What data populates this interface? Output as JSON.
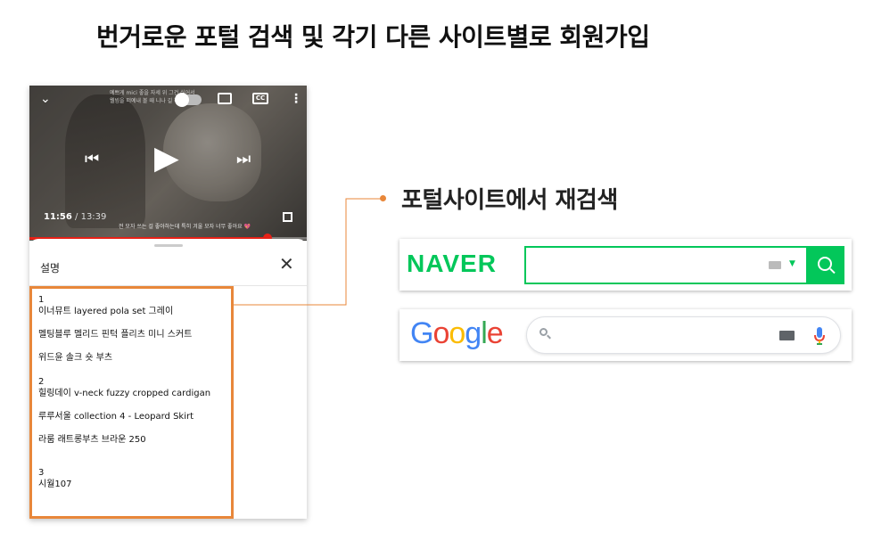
{
  "page": {
    "title": "번거로운 포털 검색 및 각기 다른 사이트별로 회원가입",
    "subtitle": "포털사이트에서 재검색",
    "accent_color": "#e8873a"
  },
  "video_player": {
    "caption_text": "예쁘게 mici 좋을 자세 위 그건 싫어서\n웰빙을 떠예내 볼 때 니나 길 하",
    "subtitle_text": "전 모자 쓰는 걸 좋아하는데 특히 겨울 모자 너무 좋아요 💖",
    "time_current": "11:56",
    "time_separator": " / ",
    "time_total": "13:39",
    "progress_fraction": 0.86,
    "progress_color": "#e62117",
    "icons": [
      "chevron-down-icon",
      "autoplay-toggle-icon",
      "cast-icon",
      "closed-caption-icon",
      "more-vert-icon",
      "previous-icon",
      "play-icon",
      "next-icon",
      "fullscreen-icon"
    ],
    "cc_label": "CC"
  },
  "description_sheet": {
    "title": "설명",
    "close_glyph": "✕",
    "groups": [
      {
        "number": "1",
        "items": [
          "이너뮤트 layered pola set 그레이",
          "멜팅블루 멜리드 핀턱 플리츠 미니 스커트",
          "위드윤 솔크 숏 부츠"
        ]
      },
      {
        "number": "2",
        "items": [
          "힐링데이 v-neck fuzzy cropped cardigan",
          "루루서울 collection 4 - Leopard Skirt",
          "라룸 래트롱부츠 브라운 250"
        ]
      },
      {
        "number": "3",
        "items": [
          "시월107"
        ]
      }
    ]
  },
  "naver": {
    "logo_text": "NAVER",
    "search_value": "",
    "brand_color": "#03c75a",
    "icons": [
      "keyboard-icon",
      "dropdown-arrow-icon",
      "search-icon"
    ]
  },
  "google": {
    "logo_letters": [
      {
        "char": "G",
        "color": "#4285f4"
      },
      {
        "char": "o",
        "color": "#ea4335"
      },
      {
        "char": "o",
        "color": "#fbbc05"
      },
      {
        "char": "g",
        "color": "#4285f4"
      },
      {
        "char": "l",
        "color": "#34a853"
      },
      {
        "char": "e",
        "color": "#ea4335"
      }
    ],
    "search_value": "",
    "icons": [
      "search-icon",
      "keyboard-icon",
      "microphone-icon"
    ]
  }
}
